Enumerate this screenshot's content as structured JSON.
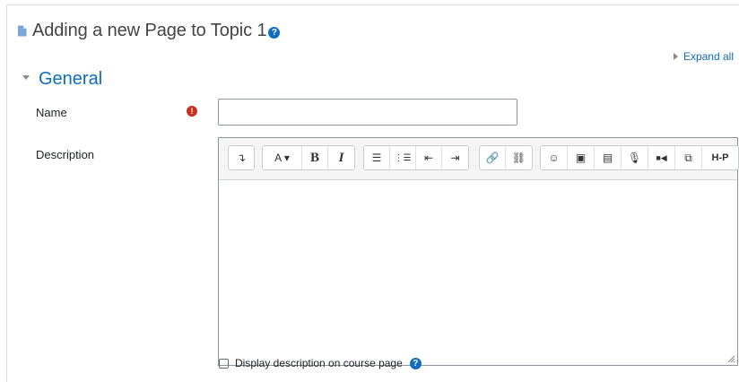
{
  "header": {
    "title": "Adding a new Page to Topic 1",
    "help_glyph": "?",
    "page_icon": "page-icon"
  },
  "expand_all": "Expand all",
  "section": {
    "title": "General"
  },
  "form": {
    "name_label": "Name",
    "name_value": "",
    "required_glyph": "!",
    "description_label": "Description",
    "checkbox_label": "Display description on course page",
    "checkbox_checked": false
  },
  "toolbar": {
    "groups": [
      [
        {
          "name": "toggle-toolbar-icon",
          "glyph": "↴"
        }
      ],
      [
        {
          "name": "font-color-icon",
          "glyph": "A ▾"
        },
        {
          "name": "bold-icon",
          "glyph": "B"
        },
        {
          "name": "italic-icon",
          "glyph": "I"
        }
      ],
      [
        {
          "name": "unordered-list-icon",
          "glyph": "☰"
        },
        {
          "name": "ordered-list-icon",
          "glyph": "⋮☰"
        },
        {
          "name": "outdent-icon",
          "glyph": "⇤"
        },
        {
          "name": "indent-icon",
          "glyph": "⇥"
        }
      ],
      [
        {
          "name": "link-icon",
          "glyph": "🔗"
        },
        {
          "name": "unlink-icon",
          "glyph": "⛓"
        }
      ],
      [
        {
          "name": "emoji-icon",
          "glyph": "☺"
        },
        {
          "name": "image-icon",
          "glyph": "▣"
        },
        {
          "name": "media-icon",
          "glyph": "▤"
        },
        {
          "name": "record-audio-icon",
          "glyph": "🎙"
        },
        {
          "name": "record-video-icon",
          "glyph": "■◀"
        },
        {
          "name": "manage-files-icon",
          "glyph": "⧉"
        },
        {
          "name": "h5p-icon",
          "glyph": "H-P"
        }
      ]
    ]
  }
}
